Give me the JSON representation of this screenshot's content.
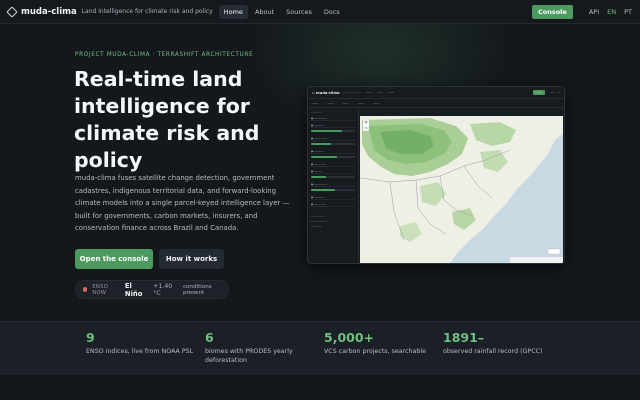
{
  "nav": {
    "brand": "muda-clima",
    "tagline": "Land intelligence for climate risk and policy",
    "links": [
      {
        "label": "Home",
        "active": true
      },
      {
        "label": "About",
        "active": false
      },
      {
        "label": "Sources",
        "active": false
      },
      {
        "label": "Docs",
        "active": false
      }
    ],
    "console_label": "Console",
    "api_label": "API",
    "languages": [
      {
        "label": "EN",
        "active": true
      },
      {
        "label": "PT",
        "active": false
      }
    ]
  },
  "hero": {
    "eyebrow": "PROJECT MUDA-CLIMA · TERRASHIFT ARCHITECTURE",
    "headline": "Real-time land intelligence for climate risk and policy",
    "description": "muda-clima fuses satellite change detection, government cadastres, indigenous territorial data, and forward-looking climate models into a single parcel-keyed intelligence layer — built for governments, carbon markets, insurers, and conservation finance across Brazil and Canada.",
    "primary_cta": "Open the console",
    "secondary_cta": "How it works"
  },
  "enso": {
    "label": "ENSO NOW",
    "phase": "El Niño",
    "anomaly": "+1.40 °C",
    "status": "conditions present"
  },
  "stats": [
    {
      "value": "9",
      "label": "ENSO indices, live from NOAA PSL"
    },
    {
      "value": "6",
      "label": "biomes with PRODES yearly deforestation"
    },
    {
      "value": "5,000+",
      "label": "VCS carbon projects, searchable"
    },
    {
      "value": "1891–",
      "label": "observed rainfall record (GPCC)"
    }
  ],
  "colors": {
    "accent": "#4c9a5d",
    "accent_text": "#6fbf7f",
    "background": "#14181d",
    "enso_indicator": "#e06a5a"
  }
}
